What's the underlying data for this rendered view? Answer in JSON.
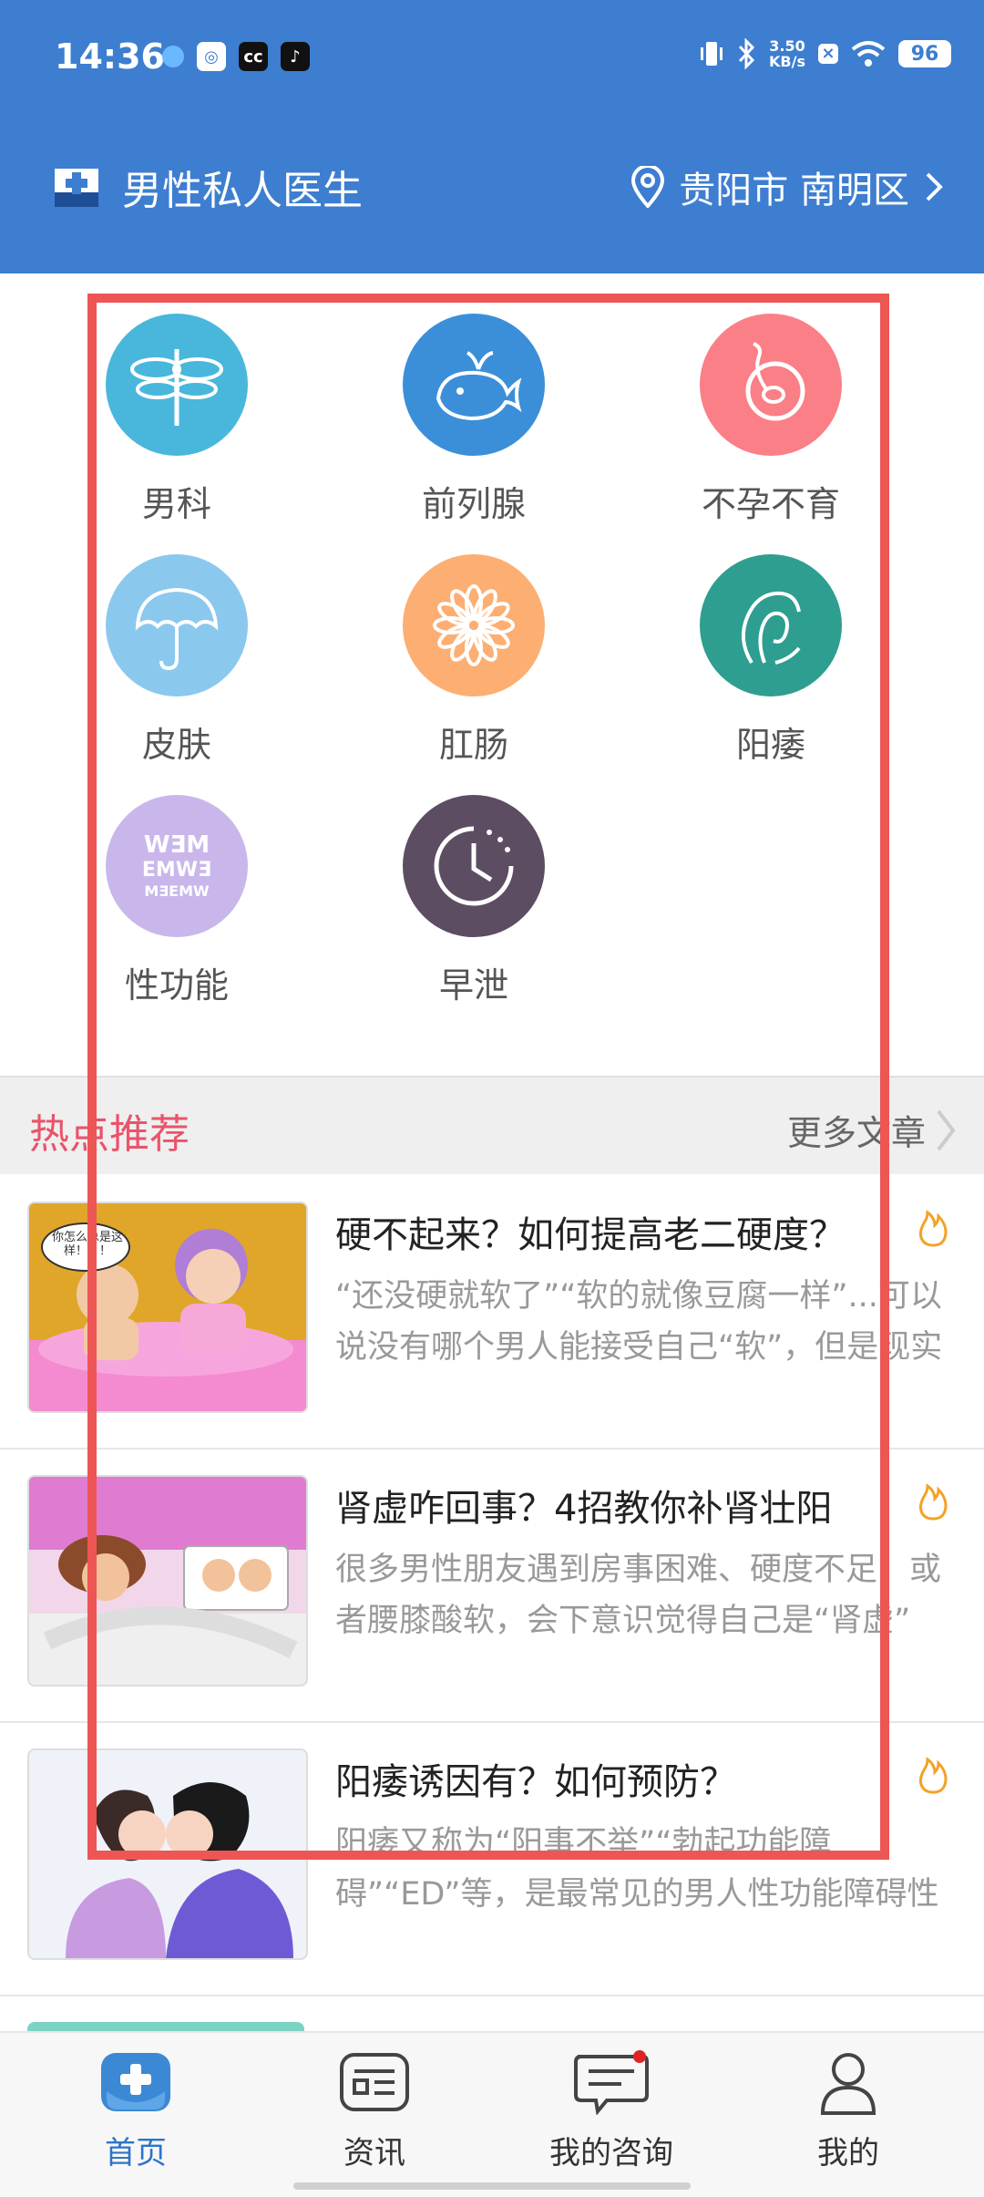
{
  "status": {
    "time": "14:36",
    "net_speed_top": "3.50",
    "net_speed_bottom": "KB/s",
    "battery": "96"
  },
  "header": {
    "title": "男性私人医生",
    "location": "贵阳市 南明区"
  },
  "categories": [
    {
      "label": "男科",
      "color": "#49b7dc",
      "icon": "dragonfly-icon"
    },
    {
      "label": "前列腺",
      "color": "#3b8fd9",
      "icon": "whale-icon"
    },
    {
      "label": "不孕不育",
      "color": "#fb7f86",
      "icon": "sperm-icon"
    },
    {
      "label": "皮肤",
      "color": "#8bc8ee",
      "icon": "umbrella-icon"
    },
    {
      "label": "肛肠",
      "color": "#fdae72",
      "icon": "flower-icon"
    },
    {
      "label": "阳痿",
      "color": "#2e9e90",
      "icon": "wilted-icon"
    },
    {
      "label": "性功能",
      "color": "#c9b7ec",
      "icon": "eye-chart-icon"
    },
    {
      "label": "早泄",
      "color": "#5c4d63",
      "icon": "clock-icon"
    }
  ],
  "section": {
    "title": "热点推荐",
    "more": "更多文章"
  },
  "articles": [
    {
      "title": "硬不起来？如何提高老二硬度？",
      "desc": "“还没硬就软了”“软的就像豆腐一样”...可以说没有哪个男人能接受自己“软”，但是现实"
    },
    {
      "title": "肾虚咋回事？4招教你补肾壮阳",
      "desc": "很多男性朋友遇到房事困难、硬度不足，或者腰膝酸软，会下意识觉得自己是“肾虚”"
    },
    {
      "title": "阳痿诱因有？如何预防？",
      "desc": "阳痿又称为“阳事不举”“勃起功能障碍”“ED”等，是最常见的男人性功能障碍性疾病，偶"
    }
  ],
  "thumb_caption": "你怎么总是这样！！！",
  "tabs": [
    {
      "label": "首页",
      "icon": "home-plus-icon"
    },
    {
      "label": "资讯",
      "icon": "news-icon"
    },
    {
      "label": "我的咨询",
      "icon": "chat-icon"
    },
    {
      "label": "我的",
      "icon": "user-icon"
    }
  ],
  "colors": {
    "header": "#3d7ed0",
    "accent_red": "#e9546b",
    "tab_active": "#2d74c9",
    "highlight_box": "#ee5555"
  }
}
